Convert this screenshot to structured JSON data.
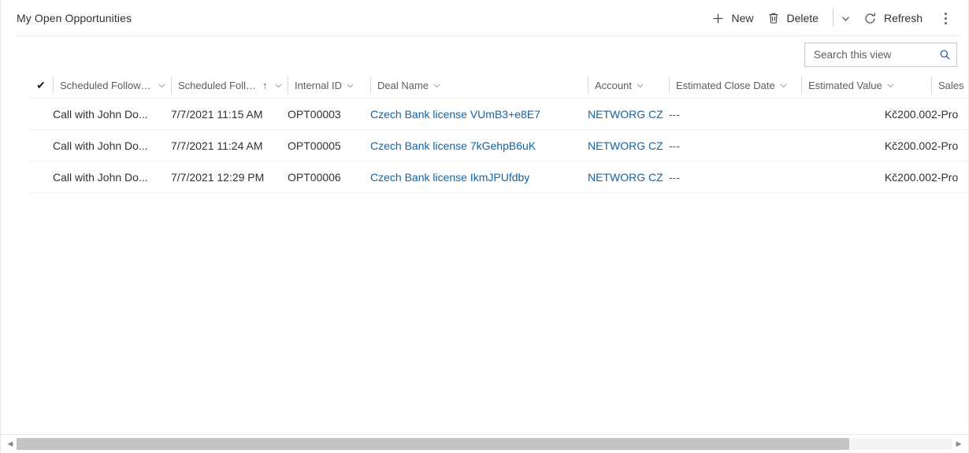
{
  "header": {
    "view_title": "My Open Opportunities"
  },
  "toolbar": {
    "new_label": "New",
    "delete_label": "Delete",
    "refresh_label": "Refresh",
    "chevron_icon": "chevron-down-icon",
    "overflow_icon": "more-commands-icon",
    "new_icon": "plus-icon",
    "delete_icon": "trash-icon",
    "refresh_icon": "refresh-icon"
  },
  "search": {
    "placeholder": "Search this view",
    "value": "",
    "icon": "search-icon"
  },
  "grid": {
    "select_all_glyph": "✔",
    "sort_ascending_glyph": "↑",
    "columns": [
      {
        "label": "Scheduled Follow-up",
        "sorted": "",
        "align": "left"
      },
      {
        "label": "Scheduled Follo...",
        "sorted": "asc",
        "align": "left"
      },
      {
        "label": "Internal ID",
        "sorted": "",
        "align": "left"
      },
      {
        "label": "Deal Name",
        "sorted": "",
        "align": "left"
      },
      {
        "label": "Account",
        "sorted": "",
        "align": "left"
      },
      {
        "label": "Estimated Close Date",
        "sorted": "",
        "align": "left"
      },
      {
        "label": "Estimated Value",
        "sorted": "",
        "align": "right"
      },
      {
        "label": "Sales",
        "sorted": "",
        "align": "left"
      }
    ],
    "rows": [
      {
        "follow_up": "Call with John Do...",
        "scheduled": "7/7/2021 11:15 AM",
        "internal_id": "OPT00003",
        "deal_name": "Czech Bank license VUmB3+e8E7",
        "account": "NETWORG CZ",
        "close_date": "---",
        "estimated_value": "Kč200.00",
        "sales_stage": "2-Pro"
      },
      {
        "follow_up": "Call with John Do...",
        "scheduled": "7/7/2021 11:24 AM",
        "internal_id": "OPT00005",
        "deal_name": "Czech Bank license 7kGehpB6uK",
        "account": "NETWORG CZ",
        "close_date": "---",
        "estimated_value": "Kč200.00",
        "sales_stage": "2-Pro"
      },
      {
        "follow_up": "Call with John Do...",
        "scheduled": "7/7/2021 12:29 PM",
        "internal_id": "OPT00006",
        "deal_name": "Czech Bank license IkmJPUfdby",
        "account": "NETWORG CZ",
        "close_date": "---",
        "estimated_value": "Kč200.00",
        "sales_stage": "2-Pro"
      }
    ]
  },
  "scrollbar": {
    "left_arrow_glyph": "◀",
    "right_arrow_glyph": "▶",
    "thumb_percent": 89
  },
  "colors": {
    "link": "#1264a3",
    "text": "#323130",
    "muted": "#605e5c",
    "border": "#e6e6e6",
    "accent": "#2b579a"
  }
}
